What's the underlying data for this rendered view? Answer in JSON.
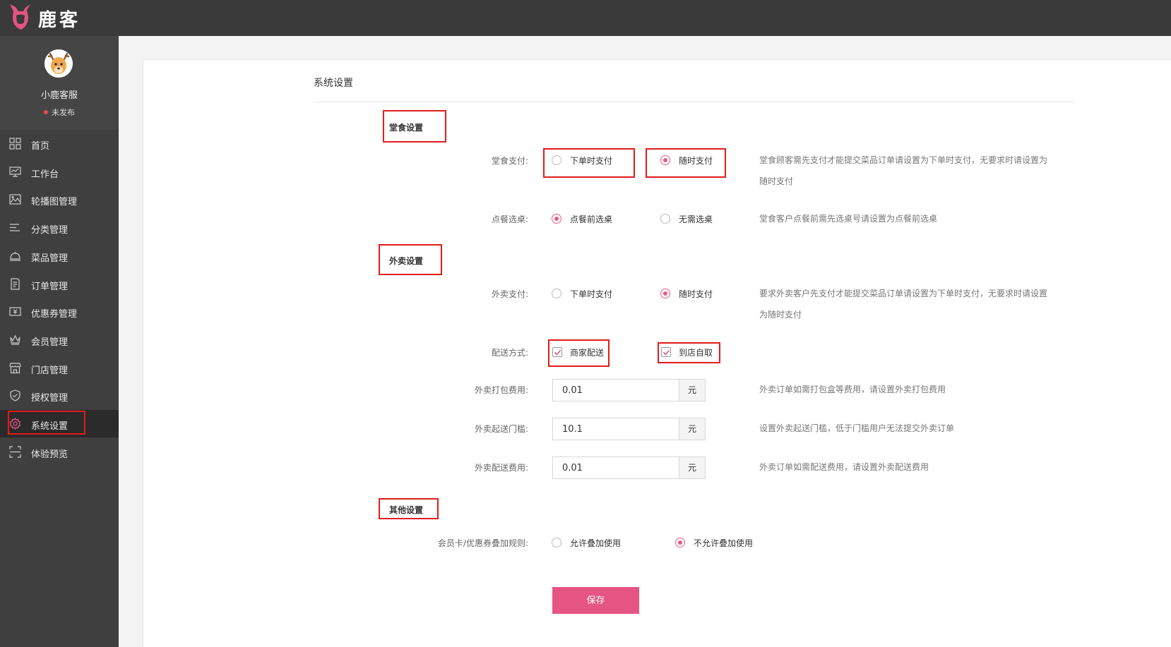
{
  "app": {
    "brand": "鹿客"
  },
  "profile": {
    "name": "小鹿客服",
    "status": "未发布"
  },
  "sidebar": {
    "items": [
      {
        "label": "首页",
        "icon": "grid-icon"
      },
      {
        "label": "工作台",
        "icon": "monitor-icon"
      },
      {
        "label": "轮播图管理",
        "icon": "image-icon"
      },
      {
        "label": "分类管理",
        "icon": "list-icon"
      },
      {
        "label": "菜品管理",
        "icon": "dish-icon"
      },
      {
        "label": "订单管理",
        "icon": "document-icon"
      },
      {
        "label": "优惠券管理",
        "icon": "coupon-icon"
      },
      {
        "label": "会员管理",
        "icon": "crown-icon"
      },
      {
        "label": "门店管理",
        "icon": "store-icon"
      },
      {
        "label": "授权管理",
        "icon": "shield-icon"
      },
      {
        "label": "系统设置",
        "icon": "gear-icon",
        "active": true
      },
      {
        "label": "体验预览",
        "icon": "scan-icon"
      }
    ]
  },
  "page": {
    "title": "系统设置"
  },
  "dine_in": {
    "section_title": "堂食设置",
    "payment": {
      "label": "堂食支付:",
      "options": [
        "下单时支付",
        "随时支付"
      ],
      "selected": "随时支付",
      "hint_line1": "堂食顾客需先支付才能提交菜品订单请设置为下单时支付，无要求时请设置为",
      "hint_line2": "随时支付"
    },
    "table_select": {
      "label": "点餐选桌:",
      "options": [
        "点餐前选桌",
        "无需选桌"
      ],
      "selected": "点餐前选桌",
      "hint": "堂食客户点餐前需先选桌号请设置为点餐前选桌"
    }
  },
  "takeout": {
    "section_title": "外卖设置",
    "payment": {
      "label": "外卖支付:",
      "options": [
        "下单时支付",
        "随时支付"
      ],
      "selected": "随时支付",
      "hint_line1": "要求外卖客户先支付才能提交菜品订单请设置为下单时支付，无要求时请设置",
      "hint_line2": "为随时支付"
    },
    "delivery": {
      "label": "配送方式:",
      "options": [
        {
          "label": "商家配送",
          "checked": true
        },
        {
          "label": "到店自取",
          "checked": true
        }
      ]
    },
    "packing_fee": {
      "label": "外卖打包费用:",
      "value": "0.01",
      "unit": "元",
      "hint": "外卖订单如需打包盒等费用，请设置外卖打包费用"
    },
    "min_order": {
      "label": "外卖起送门槛:",
      "value": "10.1",
      "unit": "元",
      "hint": "设置外卖起送门槛，低于门槛用户无法提交外卖订单"
    },
    "delivery_fee": {
      "label": "外卖配送费用:",
      "value": "0.01",
      "unit": "元",
      "hint": "外卖订单如需配送费用，请设置外卖配送费用"
    }
  },
  "other": {
    "section_title": "其他设置",
    "stacking": {
      "label": "会员卡/优惠券叠加规则:",
      "options": [
        "允许叠加使用",
        "不允许叠加使用"
      ],
      "selected": "不允许叠加使用"
    }
  },
  "actions": {
    "save_label": "保存"
  },
  "colors": {
    "accent": "#e95b84",
    "highlight_box": "#e21b1b",
    "topbar": "#3a3a3a",
    "sidebar": "#3f3f3f"
  }
}
